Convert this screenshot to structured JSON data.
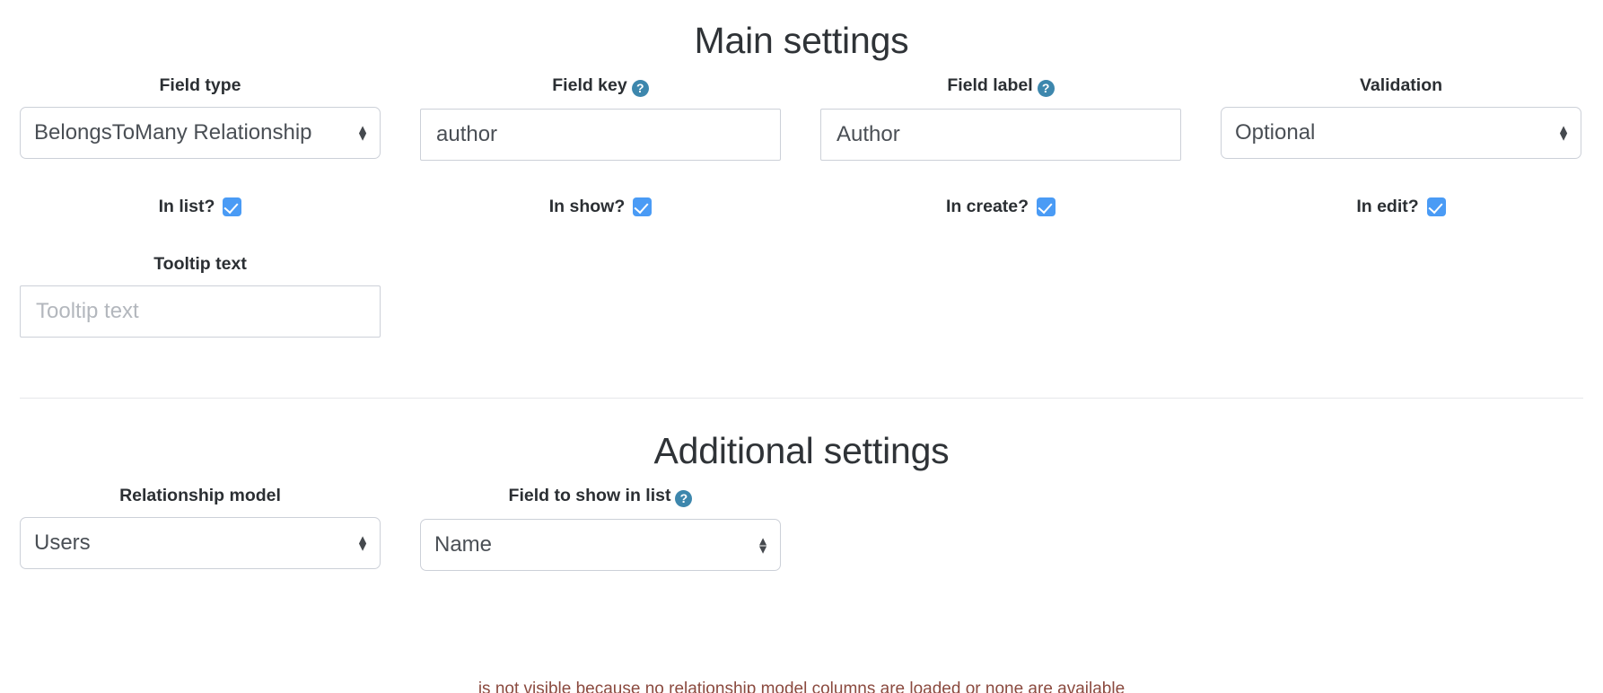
{
  "theme": {
    "background": "#ffffff",
    "heading_color": "#2f3337",
    "label_color": "#2b2f33",
    "input_border": "#ccd0d8",
    "input_text": "#4a4f55",
    "placeholder_color": "#b3b7bd",
    "checkbox_accent": "#4a9bf5",
    "help_icon_color": "#3d87ad",
    "divider_color": "#e6e7ea"
  },
  "main_settings": {
    "heading": "Main settings",
    "fields": {
      "field_type": {
        "label": "Field type",
        "control": "select",
        "value": "BelongsToMany Relationship",
        "has_help": false
      },
      "field_key": {
        "label": "Field key",
        "control": "text",
        "value": "author",
        "placeholder": "",
        "has_help": true,
        "help_icon": "question-mark-circle-icon",
        "help_glyph": "?"
      },
      "field_label": {
        "label": "Field label",
        "control": "text",
        "value": "Author",
        "placeholder": "",
        "has_help": true,
        "help_icon": "question-mark-circle-icon",
        "help_glyph": "?"
      },
      "validation": {
        "label": "Validation",
        "control": "select",
        "value": "Optional",
        "has_help": false
      }
    },
    "visibility_toggles": [
      {
        "label": "In list?",
        "checked": true,
        "name": "in-list"
      },
      {
        "label": "In show?",
        "checked": true,
        "name": "in-show"
      },
      {
        "label": "In create?",
        "checked": true,
        "name": "in-create"
      },
      {
        "label": "In edit?",
        "checked": true,
        "name": "in-edit"
      }
    ],
    "tooltip": {
      "label": "Tooltip text",
      "control": "text",
      "value": "",
      "placeholder": "Tooltip text"
    }
  },
  "additional_settings": {
    "heading": "Additional settings",
    "fields": {
      "relationship_model": {
        "label": "Relationship model",
        "control": "select",
        "value": "Users",
        "has_help": false
      },
      "field_to_show": {
        "label": "Field to show in list",
        "control": "select",
        "value": "Name",
        "has_help": true,
        "help_icon": "question-mark-circle-icon",
        "help_glyph": "?"
      }
    }
  },
  "footer_note": {
    "text": "is not visible because no relationship model columns are loaded or none are available"
  },
  "spinner": {
    "up": "▲",
    "down": "▼"
  }
}
